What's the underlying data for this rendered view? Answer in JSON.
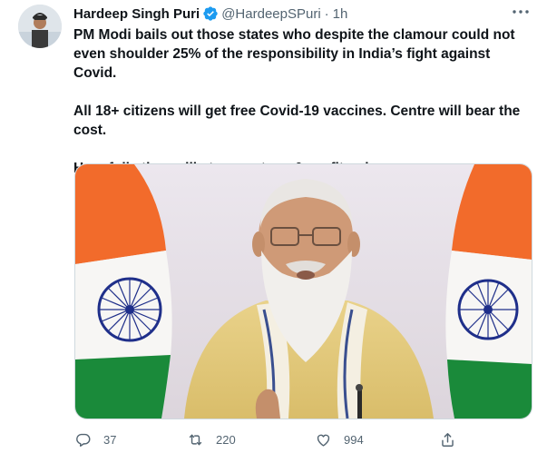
{
  "tweet": {
    "author_name": "Hardeep Singh Puri",
    "handle": "@HardeepSPuri",
    "separator": "·",
    "time": "1h",
    "paragraphs": [
      "PM Modi bails out those states who despite the clamour could not even shoulder 25% of the responsibility in India’s fight against Covid.",
      "All 18+ citizens will get free Covid-19 vaccines. Centre will bear the cost.",
      "Hopefully they will stop wastage & profiteering."
    ],
    "actions": {
      "replies": "37",
      "retweets": "220",
      "likes": "994"
    }
  },
  "colors": {
    "verified_blue": "#1d9bf0",
    "secondary_text": "#536471",
    "flag_saffron": "#f26b2b",
    "flag_green": "#1a8a3a",
    "chakra_blue": "#1f2f8a"
  },
  "icons": {
    "verified": "verified-badge-icon",
    "more": "more-icon",
    "reply": "reply-icon",
    "retweet": "retweet-icon",
    "like": "heart-icon",
    "share": "share-icon"
  }
}
